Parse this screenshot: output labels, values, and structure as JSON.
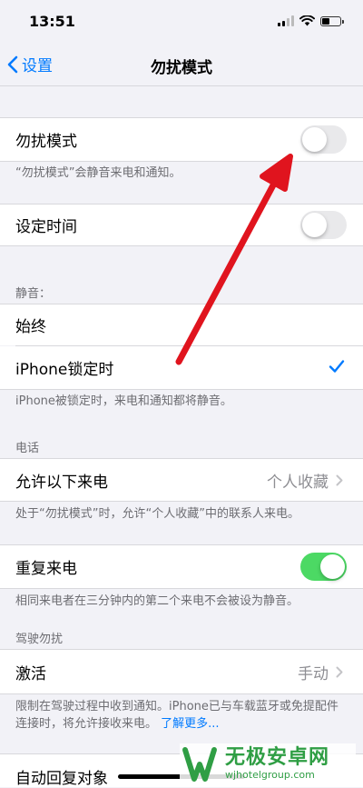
{
  "status_bar": {
    "time": "13:51"
  },
  "nav": {
    "back_label": "设置",
    "title": "勿扰模式"
  },
  "dnd": {
    "label": "勿扰模式",
    "on": false,
    "note": "“勿扰模式”会静音来电和通知。"
  },
  "scheduled": {
    "label": "设定时间",
    "on": false
  },
  "silence": {
    "header": "静音：",
    "options": [
      "始终",
      "iPhone锁定时"
    ],
    "selected": "iPhone锁定时",
    "note": "iPhone被锁定时，来电和通知都将静音。"
  },
  "phone": {
    "header": "电话",
    "allow_calls_label": "允许以下来电",
    "allow_calls_value": "个人收藏",
    "allow_calls_note": "处于“勿扰模式”时，允许“个人收藏”中的联系人来电。",
    "repeated_calls_label": "重复来电",
    "repeated_calls_on": true,
    "repeated_calls_note": "相同来电者在三分钟内的第二个来电不会被设为静音。"
  },
  "driving": {
    "header": "驾驶勿扰",
    "activate_label": "激活",
    "activate_value": "手动",
    "note": "限制在驾驶过程中收到通知。iPhone已与车载蓝牙或免提配件连接时，将允许接收来电。",
    "learn_more": "了解更多...",
    "auto_reply_label": "自动回复对象"
  },
  "watermark": {
    "main": "无极安卓网",
    "sub": "wjhotelgroup.com"
  },
  "colors": {
    "accent": "#007aff",
    "toggle_on": "#4cd964",
    "arrow": "#e0141e"
  }
}
